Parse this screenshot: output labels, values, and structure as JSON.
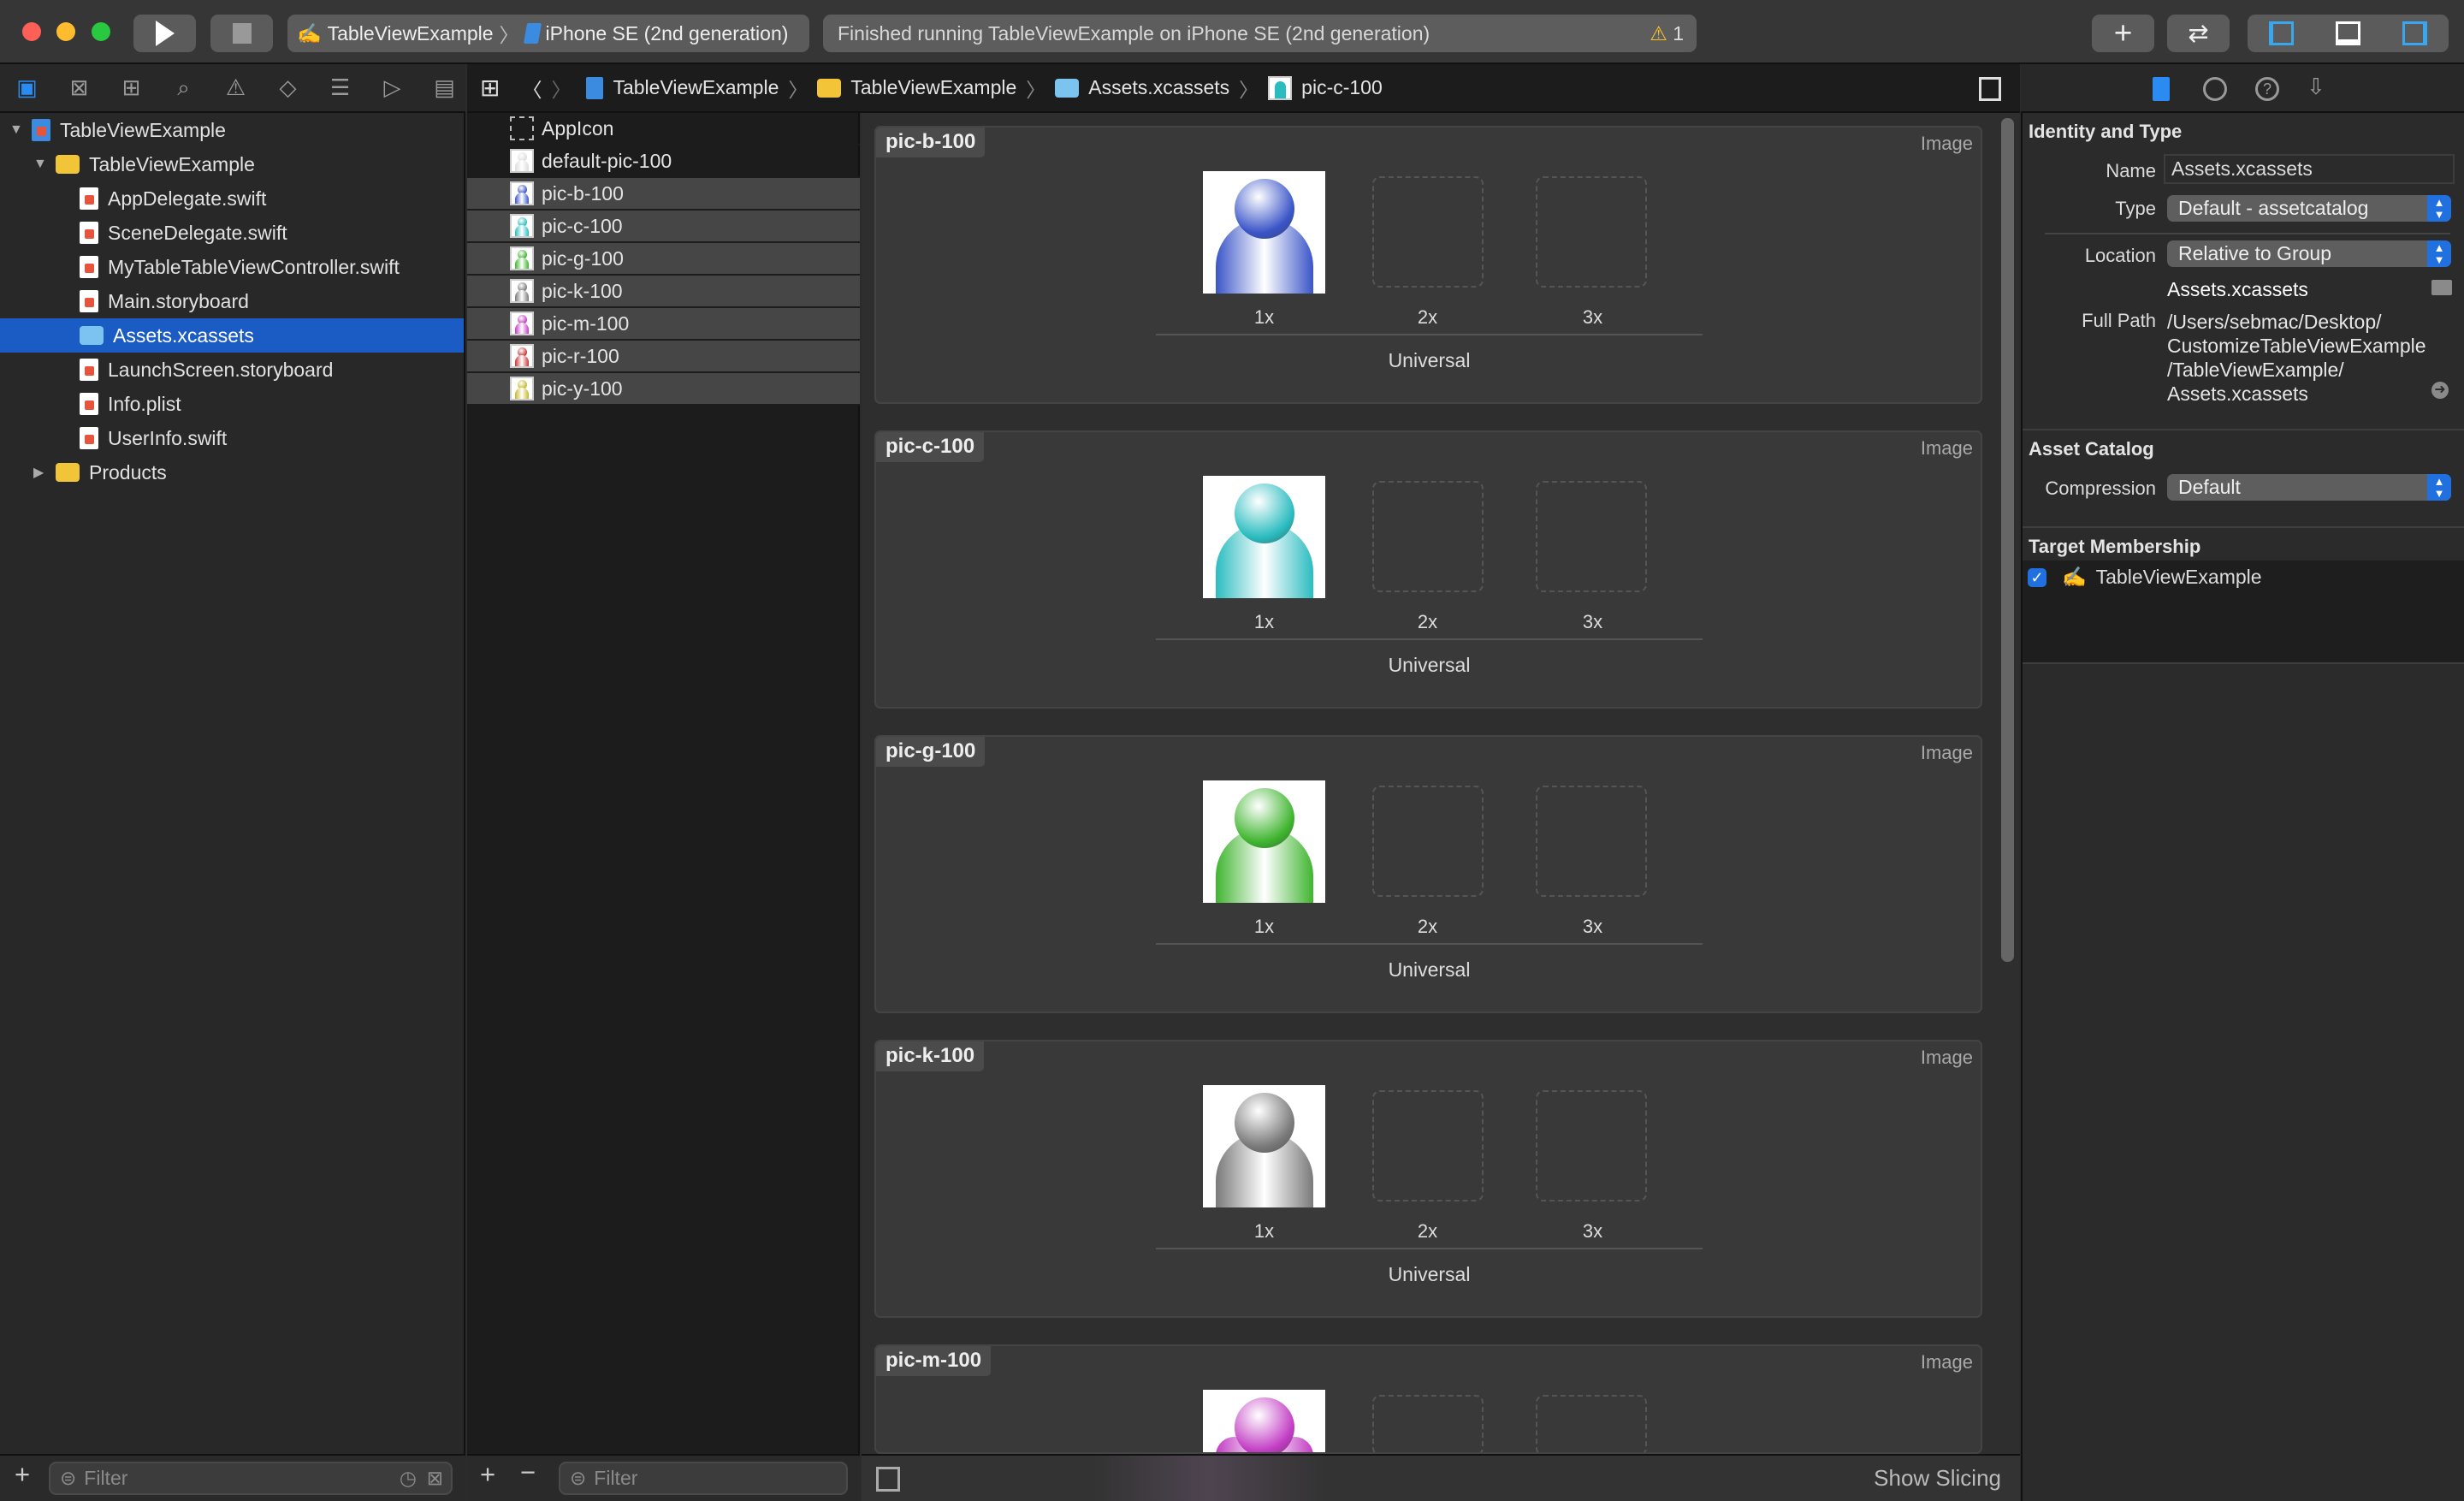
{
  "toolbar": {
    "scheme": "TableViewExample",
    "device": "iPhone SE (2nd generation)",
    "status": "Finished running TableViewExample on iPhone SE (2nd generation)",
    "warning_count": "1",
    "colors": {
      "close": "#fe5f57",
      "minimize": "#febc2e",
      "zoom": "#28c840",
      "accent": "#1a5cc4",
      "warning": "#f9c02c"
    }
  },
  "jumpbar": {
    "crumbs": [
      "TableViewExample",
      "TableViewExample",
      "Assets.xcassets",
      "pic-c-100"
    ]
  },
  "navigator": {
    "items": [
      {
        "label": "TableViewExample",
        "kind": "project",
        "level": 0,
        "expanded": true
      },
      {
        "label": "TableViewExample",
        "kind": "folder",
        "level": 1,
        "expanded": true
      },
      {
        "label": "AppDelegate.swift",
        "kind": "swift",
        "level": 2
      },
      {
        "label": "SceneDelegate.swift",
        "kind": "swift",
        "level": 2
      },
      {
        "label": "MyTableTableViewController.swift",
        "kind": "swift",
        "level": 2
      },
      {
        "label": "Main.storyboard",
        "kind": "storyboard",
        "level": 2
      },
      {
        "label": "Assets.xcassets",
        "kind": "assets",
        "level": 2,
        "selected": true
      },
      {
        "label": "LaunchScreen.storyboard",
        "kind": "storyboard",
        "level": 2
      },
      {
        "label": "Info.plist",
        "kind": "plist",
        "level": 2
      },
      {
        "label": "UserInfo.swift",
        "kind": "swift",
        "level": 2
      },
      {
        "label": "Products",
        "kind": "folder",
        "level": 1,
        "expanded": false
      }
    ],
    "filter_placeholder": "Filter"
  },
  "assets": {
    "items": [
      {
        "label": "AppIcon",
        "kind": "appicon"
      },
      {
        "label": "default-pic-100",
        "color": "#dddddd"
      },
      {
        "label": "pic-b-100",
        "color": "#3a55c8",
        "selected": true
      },
      {
        "label": "pic-c-100",
        "color": "#2bbcc0",
        "selected": true
      },
      {
        "label": "pic-g-100",
        "color": "#3fb52f",
        "selected": true
      },
      {
        "label": "pic-k-100",
        "color": "#7a7a7a",
        "selected": true
      },
      {
        "label": "pic-m-100",
        "color": "#c23cc4",
        "selected": true
      },
      {
        "label": "pic-r-100",
        "color": "#c83535",
        "selected": true
      },
      {
        "label": "pic-y-100",
        "color": "#c8b82a",
        "selected": true
      }
    ],
    "filter_placeholder": "Filter"
  },
  "editor": {
    "panels": [
      {
        "name": "pic-b-100",
        "type": "Image",
        "color": "#3a55c8"
      },
      {
        "name": "pic-c-100",
        "type": "Image",
        "color": "#2bbcc0"
      },
      {
        "name": "pic-g-100",
        "type": "Image",
        "color": "#3fb52f"
      },
      {
        "name": "pic-k-100",
        "type": "Image",
        "color": "#7a7a7a"
      },
      {
        "name": "pic-m-100",
        "type": "Image",
        "color": "#c23cc4"
      }
    ],
    "slots": [
      "1x",
      "2x",
      "3x"
    ],
    "idiom": "Universal",
    "show_slicing": "Show Slicing"
  },
  "inspector": {
    "identity": {
      "title": "Identity and Type",
      "name_label": "Name",
      "name": "Assets.xcassets",
      "type_label": "Type",
      "type": "Default - assetcatalog",
      "location_label": "Location",
      "location": "Relative to Group",
      "location_file": "Assets.xcassets",
      "fullpath_label": "Full Path",
      "fullpath": [
        "/Users/sebmac/Desktop/",
        "CustomizeTableViewExample",
        "/TableViewExample/",
        "Assets.xcassets"
      ]
    },
    "catalog": {
      "title": "Asset Catalog",
      "compression_label": "Compression",
      "compression": "Default"
    },
    "membership": {
      "title": "Target Membership",
      "target": "TableViewExample",
      "checked": true
    }
  }
}
